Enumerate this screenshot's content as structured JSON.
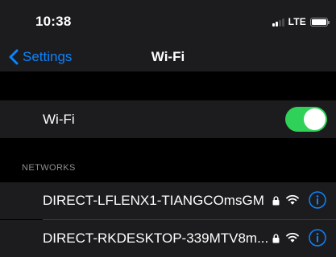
{
  "status_bar": {
    "time": "10:38",
    "network_type": "LTE",
    "signal_bars": 2,
    "signal_bars_total": 4,
    "battery_level": 1.0,
    "icons": [
      "signal-icon",
      "battery-icon"
    ]
  },
  "nav": {
    "back_label": "Settings",
    "title": "Wi-Fi",
    "back_icon": "chevron-left-icon"
  },
  "wifi_toggle": {
    "label": "Wi-Fi",
    "on": true
  },
  "networks": {
    "header": "NETWORKS",
    "items": [
      {
        "name": "DIRECT-LFLENX1-TIANGCOmsGM",
        "secured": true,
        "icons": [
          "lock-icon",
          "wifi-icon",
          "info-icon"
        ]
      },
      {
        "name": "DIRECT-RKDESKTOP-339MTV8m...",
        "secured": true,
        "icons": [
          "lock-icon",
          "wifi-icon",
          "info-icon"
        ]
      }
    ]
  },
  "colors": {
    "accent": "#0a84ff",
    "toggle_on": "#30d158",
    "background": "#000000",
    "cell_background": "#1c1c1e",
    "secondary_text": "#8e8e93",
    "separator": "#38383a"
  }
}
